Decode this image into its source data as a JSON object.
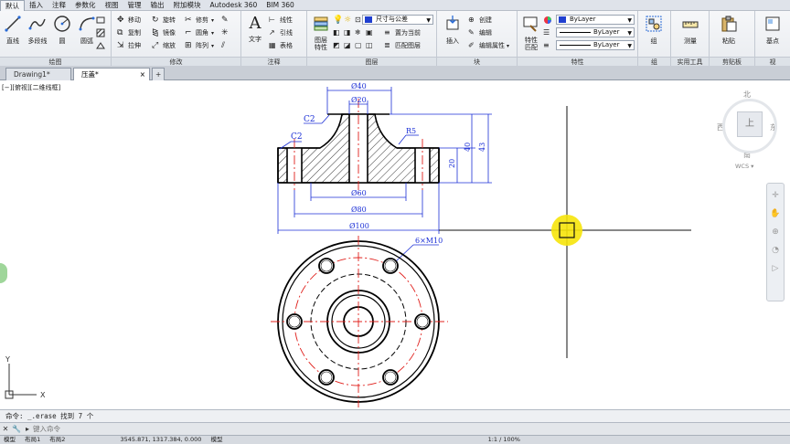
{
  "tabs": [
    "默认",
    "插入",
    "注释",
    "参数化",
    "视图",
    "管理",
    "输出",
    "附加模块",
    "Autodesk 360",
    "BIM 360"
  ],
  "ribbon": {
    "draw": {
      "title": "绘图",
      "line": "直线",
      "pline": "多段线",
      "circle": "圆",
      "arc": "圆弧"
    },
    "modify": {
      "title": "修改",
      "move": "移动",
      "rotate": "旋转",
      "trim": "修剪",
      "copy": "复制",
      "mirror": "镜像",
      "fillet": "圆角",
      "stretch": "拉伸",
      "scale": "缩放",
      "array": "阵列"
    },
    "annotation": {
      "title": "注释",
      "text": "文字",
      "dimension": "标注",
      "linear": "线性",
      "leader": "引线",
      "table": "表格"
    },
    "layers": {
      "title": "图层",
      "props": "图层\n特性",
      "layer_name": "尺寸与公差",
      "set_current": "置为当前",
      "match": "匹配图层"
    },
    "block": {
      "title": "块",
      "insert": "插入",
      "create": "创建",
      "edit": "编辑",
      "edit_attr": "编辑属性"
    },
    "properties": {
      "title": "特性",
      "match": "特性\n匹配",
      "color": "ByLayer",
      "linetype": "ByLayer",
      "lineweight": "ByLayer"
    },
    "groups": {
      "title": "组",
      "group": "组"
    },
    "utilities": {
      "title": "实用工具",
      "measure": "测量"
    },
    "clipboard": {
      "title": "剪贴板",
      "paste": "粘贴"
    },
    "view": {
      "title": "视",
      "base": "基点"
    }
  },
  "doc_tabs": [
    "Drawing1*",
    "压盖*"
  ],
  "viewport_label": "[−][俯视][二维线框]",
  "viewcube": {
    "north": "北",
    "south": "南",
    "east": "东",
    "west": "西",
    "face": "上",
    "wcs": "WCS"
  },
  "drawing": {
    "dims": {
      "d40": "Ø40",
      "d20": "Ø20",
      "d60": "Ø60",
      "d80": "Ø80",
      "d100": "Ø100",
      "h40": "40",
      "h43": "43",
      "h20": "20",
      "c2a": "C2",
      "c2b": "C2",
      "r5": "R5",
      "holes": "6×M10"
    }
  },
  "ucs": {
    "x": "X",
    "y": "Y"
  },
  "command": {
    "history": "命令: _.erase 找到 7 个",
    "placeholder": "键入命令"
  },
  "status": {
    "coords": "3545.871, 1317.384, 0.000",
    "mode": "模型",
    "scale": "1:1 / 100%",
    "layout_tabs": [
      "模型",
      "布局1",
      "布局2"
    ]
  }
}
